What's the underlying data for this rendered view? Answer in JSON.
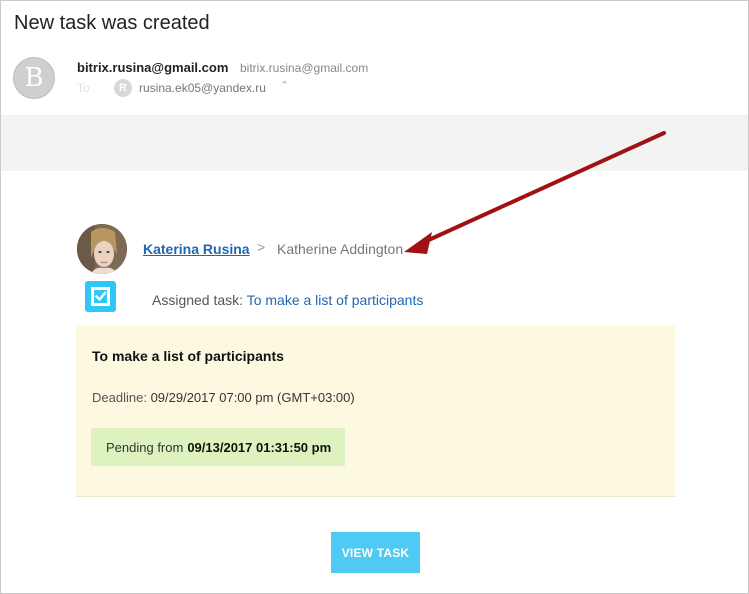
{
  "email": {
    "subject": "New task was created",
    "sender_initial": "B",
    "from_name": "bitrix.rusina@gmail.com",
    "from_email": "bitrix.rusina@gmail.com",
    "to_label": "To",
    "to_initial": "R",
    "to_email": "rusina.ek05@yandex.ru",
    "expand_glyph": "⌃"
  },
  "notification": {
    "author": "Katerina Rusina",
    "separator": ">",
    "recipient": "Katherine Addington",
    "assigned_label": "Assigned task:",
    "task_link": "To make a list of participants"
  },
  "task_card": {
    "title": "To make a list of participants",
    "deadline_label": "Deadline:",
    "deadline_value": "09/29/2017 07:00 pm (GMT+03:00)",
    "status_label": "Pending from",
    "status_value": "09/13/2017 01:31:50 pm"
  },
  "actions": {
    "view_task": "VIEW TASK"
  },
  "colors": {
    "link": "#2067b0",
    "task_icon": "#2fc7f7",
    "card_bg": "#fdf9e1",
    "status_bg": "#def2c0",
    "button_bg": "#4fcaf3",
    "annotation_arrow": "#a01212"
  },
  "icons": {
    "task": "task-checkbox-icon",
    "expand": "chevron-up-icon",
    "annotation": "arrow-annotation-icon"
  }
}
